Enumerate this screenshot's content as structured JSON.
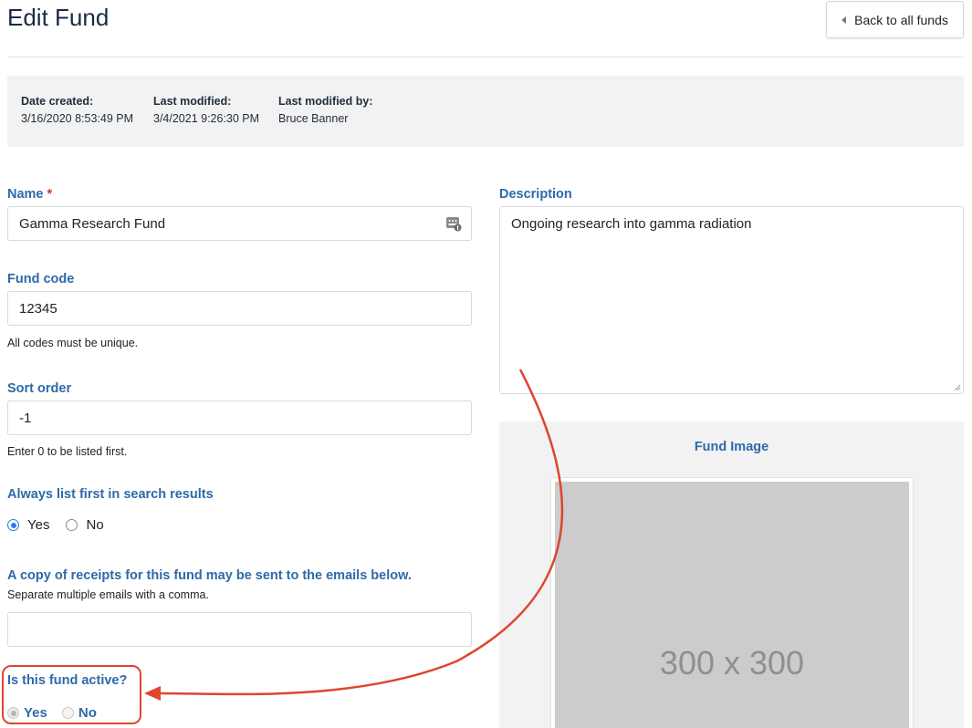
{
  "header": {
    "title": "Edit Fund",
    "back_label": "Back to all funds"
  },
  "meta": {
    "date_created_label": "Date created:",
    "date_created": "3/16/2020 8:53:49 PM",
    "last_modified_label": "Last modified:",
    "last_modified": "3/4/2021 9:26:30 PM",
    "last_modified_by_label": "Last modified by:",
    "last_modified_by": "Bruce Banner"
  },
  "form": {
    "name": {
      "label": "Name",
      "required_mark": "*",
      "value": "Gamma Research Fund"
    },
    "fund_code": {
      "label": "Fund code",
      "value": "12345",
      "help": "All codes must be unique."
    },
    "sort_order": {
      "label": "Sort order",
      "value": "-1",
      "help": "Enter 0 to be listed first."
    },
    "always_first": {
      "label": "Always list first in search results",
      "yes": "Yes",
      "no": "No",
      "selected": "Yes"
    },
    "receipts": {
      "label": "A copy of receipts for this fund may be sent to the emails below.",
      "help": "Separate multiple emails with a comma.",
      "value": ""
    },
    "active": {
      "label": "Is this fund active?",
      "yes": "Yes",
      "no": "No",
      "selected": "Yes"
    },
    "description": {
      "label": "Description",
      "value": "Ongoing research into gamma radiation"
    },
    "image": {
      "label": "Fund Image",
      "placeholder_text": "300 x 300"
    }
  },
  "annotation": {
    "color": "#e0452f"
  },
  "icons": {
    "back": "caret-left-icon",
    "name_field": "password-manager-icon",
    "resize": "resize-grip-icon"
  }
}
